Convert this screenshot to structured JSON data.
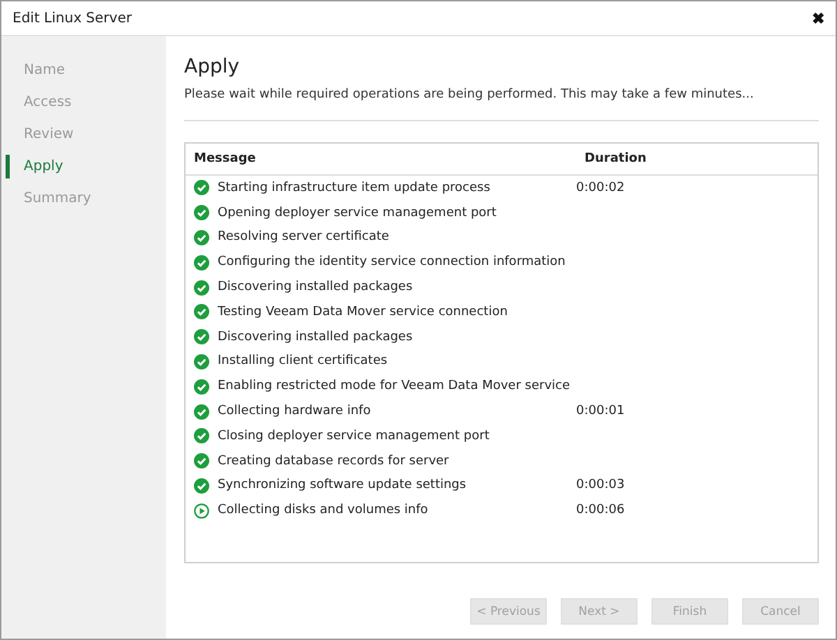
{
  "window": {
    "title": "Edit Linux Server",
    "close": "✖"
  },
  "steps": [
    {
      "label": "Name",
      "selected": false
    },
    {
      "label": "Access",
      "selected": false
    },
    {
      "label": "Review",
      "selected": false
    },
    {
      "label": "Apply",
      "selected": true
    },
    {
      "label": "Summary",
      "selected": false
    }
  ],
  "heading": "Apply",
  "description": "Please wait while required operations are being performed. This may take a few minutes...",
  "table": {
    "columns": [
      "Message",
      "Duration"
    ],
    "rows": [
      {
        "kind": "done",
        "message": "Starting infrastructure item update process",
        "duration": "0:00:02"
      },
      {
        "kind": "done",
        "message": "Opening deployer service management port"
      },
      {
        "kind": "done",
        "message": "Resolving server certificate"
      },
      {
        "kind": "done",
        "message": "Configuring the identity service connection information"
      },
      {
        "kind": "done",
        "message": "Discovering installed packages"
      },
      {
        "kind": "done",
        "message": "Testing Veeam Data Mover service connection"
      },
      {
        "kind": "done",
        "message": "Discovering installed packages"
      },
      {
        "kind": "done",
        "message": "Installing client certificates"
      },
      {
        "kind": "done",
        "message": "Enabling restricted mode for Veeam Data Mover service"
      },
      {
        "kind": "done",
        "message": "Collecting hardware info",
        "duration": "0:00:01"
      },
      {
        "kind": "done",
        "message": "Closing deployer service management port"
      },
      {
        "kind": "done",
        "message": "Creating database records for server"
      },
      {
        "kind": "done",
        "message": "Synchronizing software update settings",
        "duration": "0:00:03"
      },
      {
        "kind": "running",
        "message": "Collecting disks and volumes info",
        "duration": "0:00:06"
      }
    ]
  },
  "buttons": [
    {
      "label": "< Previous",
      "disabled": true
    },
    {
      "label": "Next >",
      "disabled": true
    },
    {
      "label": "Finish",
      "disabled": true
    },
    {
      "label": "Cancel",
      "disabled": true
    }
  ]
}
